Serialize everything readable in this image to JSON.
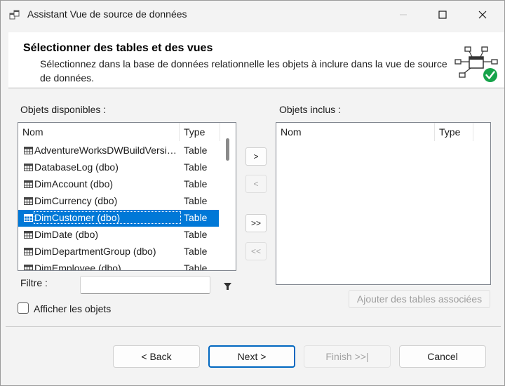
{
  "window": {
    "title": "Assistant Vue de source de données",
    "icon": "datasource-view-icon"
  },
  "header": {
    "title": "Sélectionner des tables et des vues",
    "description": "Sélectionnez dans la base de données relationnelle les objets à inclure dans la vue de source de données."
  },
  "available": {
    "label": "Objets disponibles :",
    "columns": [
      "Nom",
      "Type"
    ],
    "rows": [
      {
        "name": "AdventureWorksDWBuildVersion (dbo)",
        "type": "Table"
      },
      {
        "name": "DatabaseLog (dbo)",
        "type": "Table"
      },
      {
        "name": "DimAccount (dbo)",
        "type": "Table"
      },
      {
        "name": "DimCurrency (dbo)",
        "type": "Table"
      },
      {
        "name": "DimCustomer (dbo)",
        "type": "Table"
      },
      {
        "name": "DimDate (dbo)",
        "type": "Table"
      },
      {
        "name": "DimDepartmentGroup (dbo)",
        "type": "Table"
      },
      {
        "name": "DimEmployee (dbo)",
        "type": "Table"
      }
    ],
    "selected": "DimCustomer (dbo)"
  },
  "included": {
    "label": "Objets inclus :",
    "columns": [
      "Nom",
      "Type"
    ]
  },
  "move_buttons": {
    "add": ">",
    "remove": "<",
    "add_all": ">>",
    "remove_all": "<<"
  },
  "filter": {
    "label": "Filtre :",
    "value": ""
  },
  "add_related_label": "Ajouter des tables associées",
  "show_system_objects": {
    "label": "Afficher les objets",
    "checked": false
  },
  "footer": {
    "back": "< Back",
    "next": "Next >",
    "finish": "Finish >>|",
    "cancel": "Cancel"
  },
  "colors": {
    "selection": "#0078d7",
    "check_badge": "#16a34a"
  }
}
